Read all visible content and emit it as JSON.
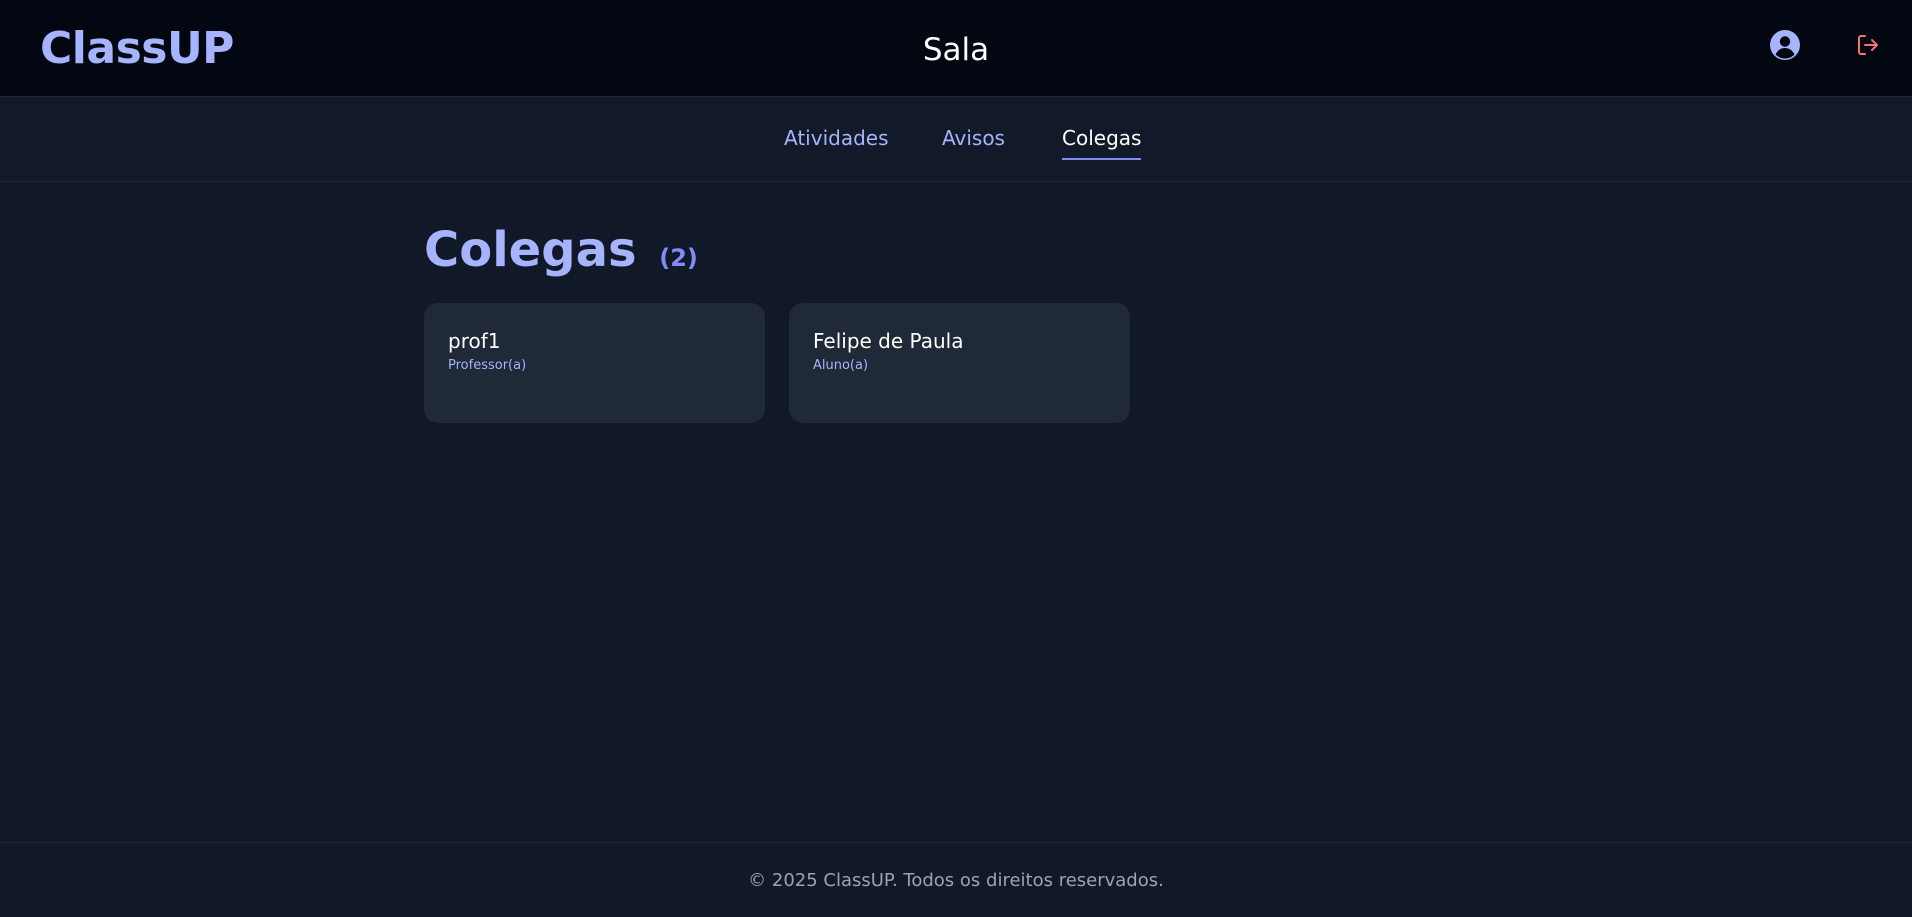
{
  "header": {
    "logo": "ClassUP",
    "title": "Sala",
    "user_icon": "user-circle-icon",
    "logout_icon": "logout-icon",
    "accent_color": "#a5b4fc",
    "logout_color": "#f87171"
  },
  "tabs": [
    {
      "label": "Atividades",
      "active": false
    },
    {
      "label": "Avisos",
      "active": false
    },
    {
      "label": "Colegas",
      "active": true
    }
  ],
  "section": {
    "title": "Colegas",
    "count": "(2)"
  },
  "members": [
    {
      "name": "prof1",
      "role": "Professor(a)"
    },
    {
      "name": "Felipe de Paula",
      "role": "Aluno(a)"
    }
  ],
  "footer": {
    "text": "© 2025 ClassUP. Todos os direitos reservados."
  }
}
